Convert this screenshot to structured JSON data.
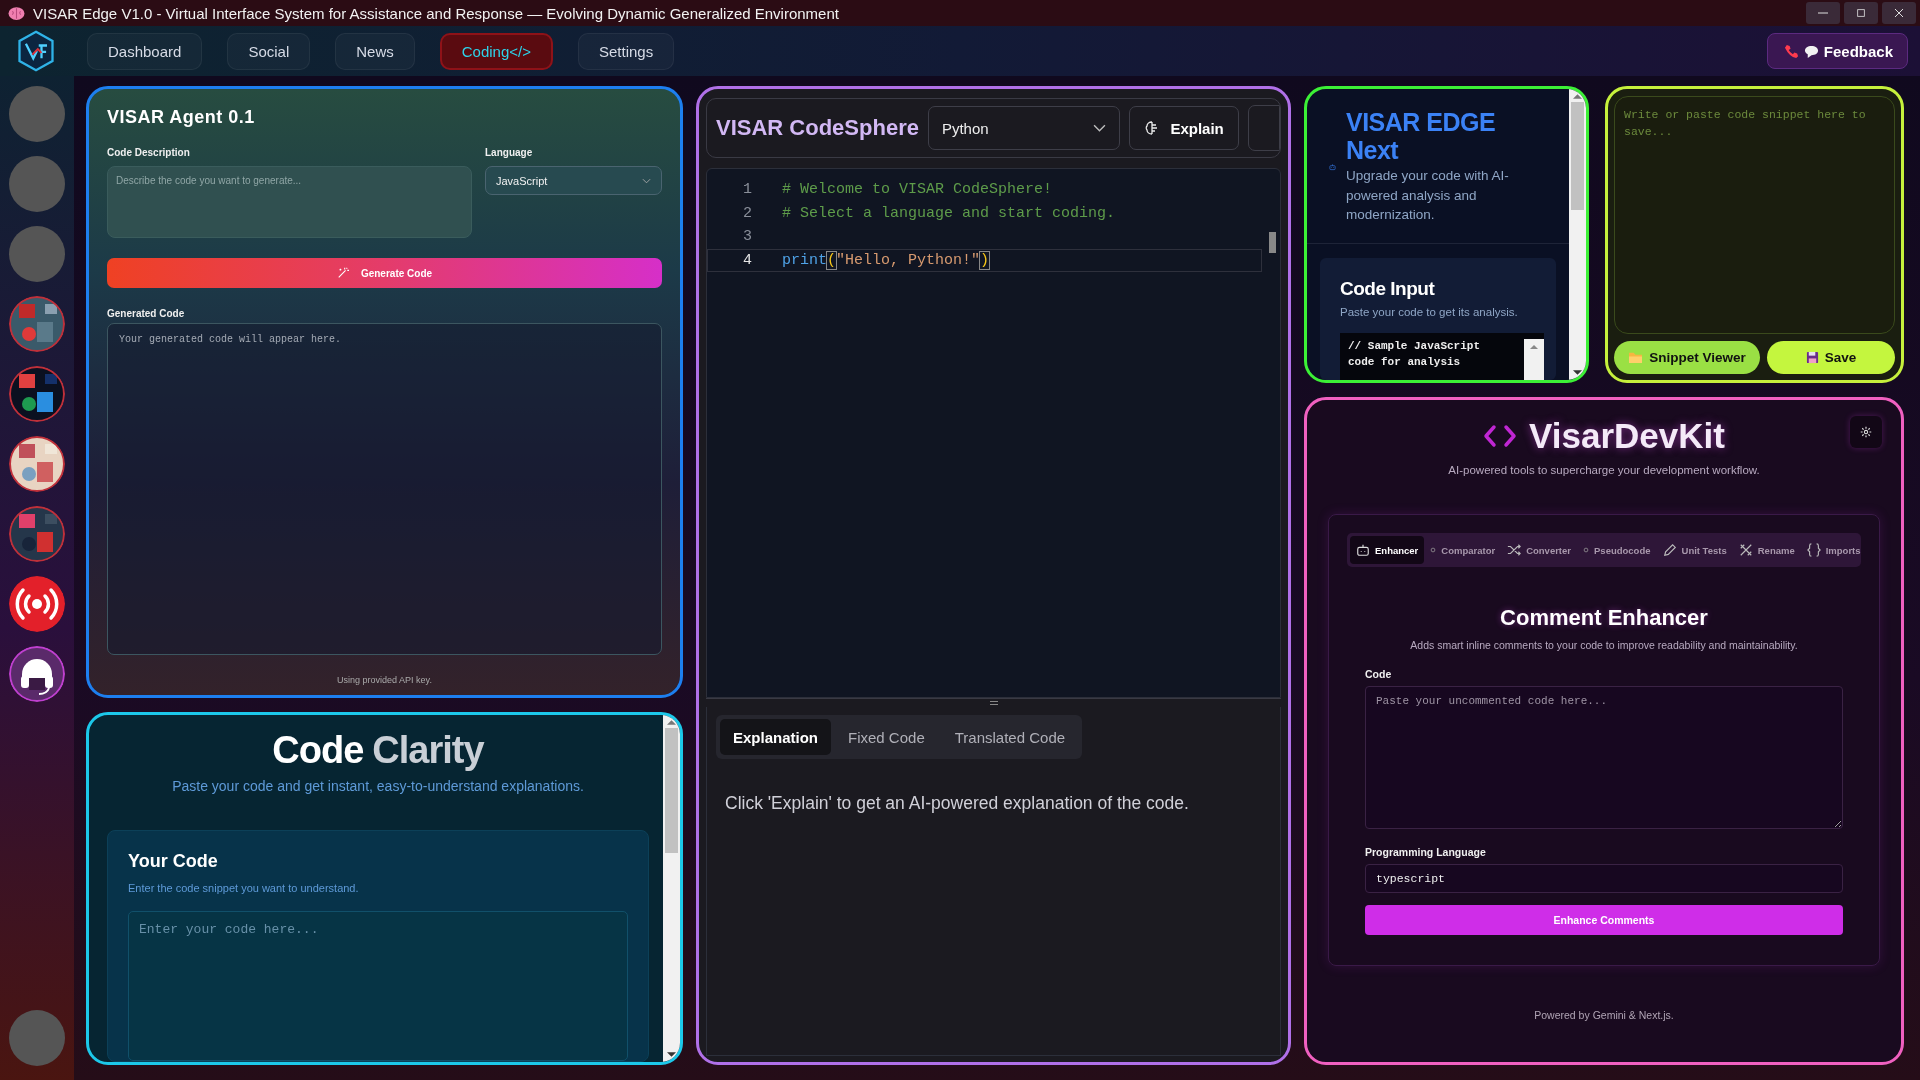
{
  "window": {
    "title": "VISAR Edge V1.0 - Virtual Interface System for Assistance and Response — Evolving Dynamic Generalized Environment"
  },
  "nav": {
    "tabs": [
      {
        "label": "Dashboard",
        "selected": false
      },
      {
        "label": "Social",
        "selected": false
      },
      {
        "label": "News",
        "selected": false
      },
      {
        "label": "Coding</>",
        "selected": true
      },
      {
        "label": "Settings",
        "selected": false
      }
    ],
    "feedback": "Feedback"
  },
  "sidebar": {
    "items": [
      {
        "kind": "blank"
      },
      {
        "kind": "blank"
      },
      {
        "kind": "blank"
      },
      {
        "kind": "picture"
      },
      {
        "kind": "picture"
      },
      {
        "kind": "picture"
      },
      {
        "kind": "picture"
      },
      {
        "kind": "broadcast"
      },
      {
        "kind": "headset"
      }
    ],
    "bottom_item": {
      "kind": "blank"
    }
  },
  "agent": {
    "title": "VISAR Agent 0.1",
    "description": {
      "label": "Code Description",
      "placeholder": "Describe the code you want to generate..."
    },
    "language": {
      "label": "Language",
      "value": "JavaScript"
    },
    "generate_button": "Generate Code",
    "output": {
      "label": "Generated Code",
      "placeholder": "Your generated code will appear here."
    },
    "note": "Using provided API key."
  },
  "clarity": {
    "title": "Code",
    "title_accent": "Clarity",
    "subtitle": "Paste your code and get instant, easy-to-understand explanations.",
    "card": {
      "title": "Your Code",
      "subtitle": "Enter the code snippet you want to understand.",
      "input": {
        "placeholder": "Enter your code here..."
      }
    }
  },
  "codesphere": {
    "title": "VISAR CodeSphere",
    "language": "Python",
    "explain_button": "Explain",
    "lines": [
      {
        "number": "1",
        "active": false,
        "tokens": [
          {
            "kind": "comment",
            "text": "# Welcome to VISAR CodeSphere!"
          }
        ]
      },
      {
        "number": "2",
        "active": false,
        "tokens": [
          {
            "kind": "comment",
            "text": "# Select a language and start coding."
          }
        ]
      },
      {
        "number": "3",
        "active": false
      },
      {
        "number": "4",
        "active": true,
        "tokens": [
          {
            "kind": "function",
            "text": "print"
          },
          {
            "kind": "bracket",
            "text": "("
          },
          {
            "kind": "string",
            "text": "\"Hello, Python!\""
          },
          {
            "kind": "bracket",
            "text": ")"
          }
        ]
      }
    ],
    "tabs": [
      {
        "label": "Explanation",
        "selected": true
      },
      {
        "label": "Fixed Code",
        "selected": false
      },
      {
        "label": "Translated Code",
        "selected": false
      }
    ],
    "output": "Click 'Explain' to get an AI-powered explanation of the code."
  },
  "edge": {
    "title": "VISAR EDGE Next",
    "description": "Upgrade your code with AI-powered analysis and modernization.",
    "card": {
      "title": "Code Input",
      "subtitle": "Paste your code to get its analysis.",
      "code": "// Sample JavaScript code for analysis"
    }
  },
  "snippet": {
    "input": {
      "placeholder": "Write or paste code snippet here to save..."
    },
    "viewer_button": "Snippet Viewer",
    "save_button": "Save"
  },
  "devkit": {
    "title": "VisarDevKit",
    "subtitle": "AI-powered tools to supercharge your development workflow.",
    "tabs": [
      {
        "label": "Enhancer",
        "selected": true
      },
      {
        "label": "Comparator",
        "selected": false
      },
      {
        "label": "Converter",
        "selected": false
      },
      {
        "label": "Pseudocode",
        "selected": false
      },
      {
        "label": "Unit Tests",
        "selected": false
      },
      {
        "label": "Rename",
        "selected": false
      },
      {
        "label": "Imports",
        "selected": false
      }
    ],
    "tool": {
      "title": "Comment Enhancer",
      "description": "Adds smart inline comments to your code to improve readability and maintainability.",
      "code": {
        "label": "Code",
        "placeholder": "Paste your uncommented code here..."
      },
      "language": {
        "label": "Programming Language",
        "value": "typescript"
      },
      "button": "Enhance Comments"
    },
    "footer": "Powered by Gemini & Next.js."
  }
}
